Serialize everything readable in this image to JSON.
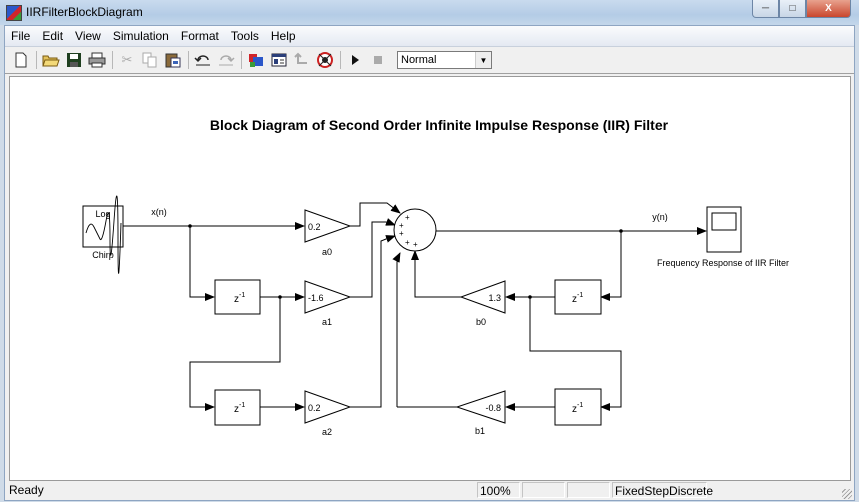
{
  "window": {
    "title": "IIRFilterBlockDiagram",
    "controls": {
      "minimize": "minimize-icon",
      "maximize": "maximize-icon",
      "close": "close-icon"
    }
  },
  "menu": [
    "File",
    "Edit",
    "View",
    "Simulation",
    "Format",
    "Tools",
    "Help"
  ],
  "toolbar": {
    "buttons": [
      {
        "name": "new-model",
        "icon": "new-document-icon",
        "enabled": true
      },
      {
        "name": "open",
        "icon": "open-folder-icon",
        "enabled": true
      },
      {
        "name": "save",
        "icon": "save-disk-icon",
        "enabled": true
      },
      {
        "name": "print",
        "icon": "printer-icon",
        "enabled": true
      },
      {
        "name": "cut",
        "icon": "scissors-icon",
        "enabled": false
      },
      {
        "name": "copy",
        "icon": "copy-icon",
        "enabled": false
      },
      {
        "name": "paste",
        "icon": "paste-icon",
        "enabled": true
      },
      {
        "name": "undo",
        "icon": "undo-icon",
        "enabled": true
      },
      {
        "name": "redo",
        "icon": "redo-icon",
        "enabled": false
      },
      {
        "name": "library-browser",
        "icon": "library-browser-icon",
        "enabled": true
      },
      {
        "name": "model-explorer",
        "icon": "model-explorer-icon",
        "enabled": true
      },
      {
        "name": "go-to-parent",
        "icon": "parent-icon",
        "enabled": false
      },
      {
        "name": "debug",
        "icon": "debug-icon",
        "enabled": true
      },
      {
        "name": "start-simulation",
        "icon": "play-icon",
        "enabled": true
      },
      {
        "name": "stop-simulation",
        "icon": "stop-icon",
        "enabled": false
      }
    ],
    "sim_mode": {
      "selected": "Normal"
    }
  },
  "diagram": {
    "title": "Block Diagram of Second Order Infinite Impulse Response (IIR) Filter",
    "source": {
      "label": "Chirp",
      "text": "Log"
    },
    "signals": {
      "input": "x(n)",
      "output": "y(n)"
    },
    "scope": {
      "label": "Frequency Response of IIR Filter"
    },
    "delay_text": {
      "base": "z",
      "exp": "-1"
    },
    "gains": {
      "a0": {
        "name": "a0",
        "value": "0.2"
      },
      "a1": {
        "name": "a1",
        "value": "-1.6"
      },
      "a2": {
        "name": "a2",
        "value": "0.2"
      },
      "b0": {
        "name": "b0",
        "value": "1.3"
      },
      "b1": {
        "name": "b1",
        "value": "-0.8"
      }
    },
    "sum_signs": [
      "+",
      "+",
      "+",
      "+",
      "+"
    ]
  },
  "status": {
    "message": "Ready",
    "zoom": "100%",
    "empty1": "",
    "empty2": "",
    "solver": "FixedStepDiscrete"
  }
}
